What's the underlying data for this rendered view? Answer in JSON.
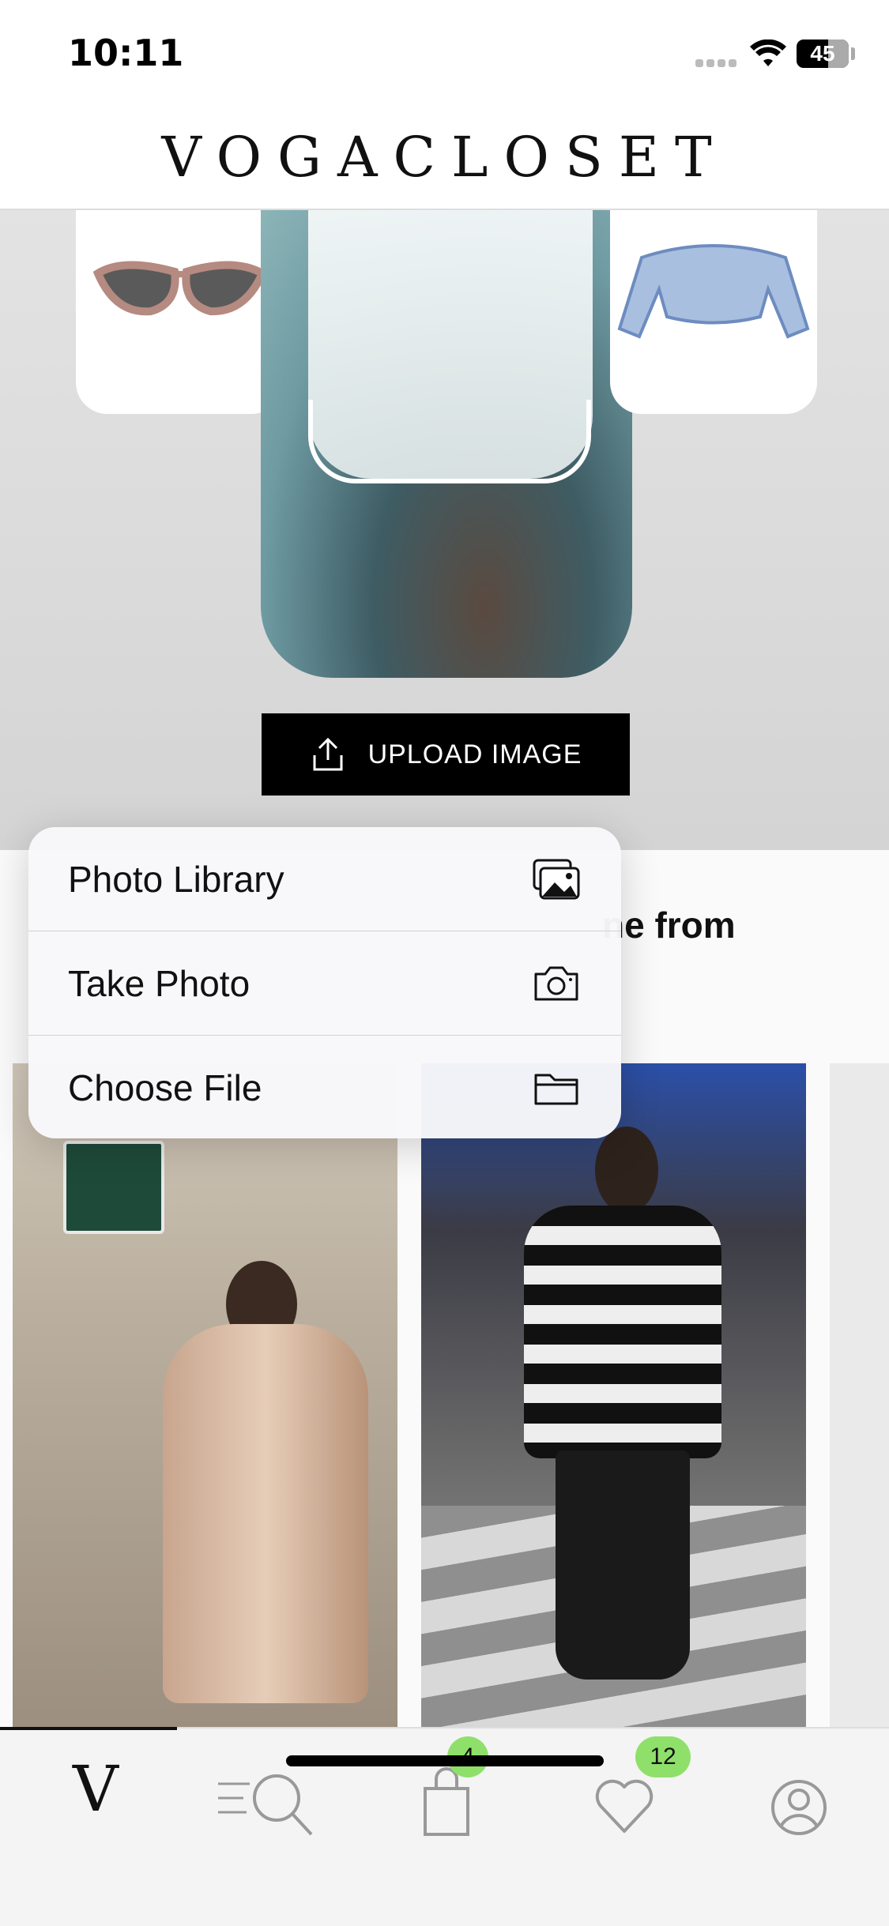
{
  "status_bar": {
    "time": "10:11",
    "battery": "45"
  },
  "header": {
    "brand": "VOGACLOSET"
  },
  "hero": {
    "upload_label": "UPLOAD IMAGE"
  },
  "section": {
    "title_fragment": "ne from"
  },
  "menu": {
    "items": [
      {
        "label": "Photo Library",
        "icon": "photo-library-icon"
      },
      {
        "label": "Take Photo",
        "icon": "camera-icon"
      },
      {
        "label": "Choose File",
        "icon": "folder-icon"
      }
    ]
  },
  "tabbar": {
    "home_label": "V",
    "bag_count": "4",
    "favorites_count": "12"
  }
}
